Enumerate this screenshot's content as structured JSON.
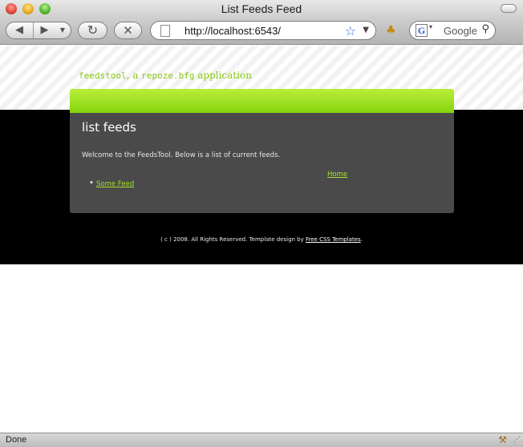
{
  "window": {
    "title": "List Feeds Feed"
  },
  "toolbar": {
    "back_icon": "◀",
    "forward_icon": "▶",
    "history_icon": "▼",
    "reload_icon": "↻",
    "stop_icon": "✕",
    "url": "http://localhost:6543/",
    "bookmark_icon": "☆",
    "url_dropdown_icon": "▼",
    "rss_icon": "♣",
    "search_engine_icon": "G",
    "search_engine_dropdown_icon": "▾",
    "search_placeholder": "Google",
    "search_icon": "⚲"
  },
  "page": {
    "site_title_mono_1": "feedstool",
    "site_title_sep": ", a ",
    "site_title_mono_2": "repoze.bfg",
    "site_title_suffix": " application",
    "heading": "list feeds",
    "welcome_text": "Welcome to the FeedsTool. Below is a list of current feeds.",
    "home_link": "Home",
    "bullet_glyph": "•",
    "feeds": [
      {
        "label": "Some Feed"
      }
    ],
    "footer_text": "( c ) 2008. All Rights Reserved. Template design by ",
    "footer_link": "Free CSS Templates",
    "footer_end": ".",
    "colors": {
      "accent_green": "#a6e22e",
      "green_bar_top": "#b9ee3a",
      "green_bar_bottom": "#86d30c",
      "box_bg": "#4a4a4a",
      "band_bg": "#000000"
    }
  },
  "statusbar": {
    "text": "Done",
    "activity_icon": "⚒",
    "grip_icon": "⋰"
  }
}
